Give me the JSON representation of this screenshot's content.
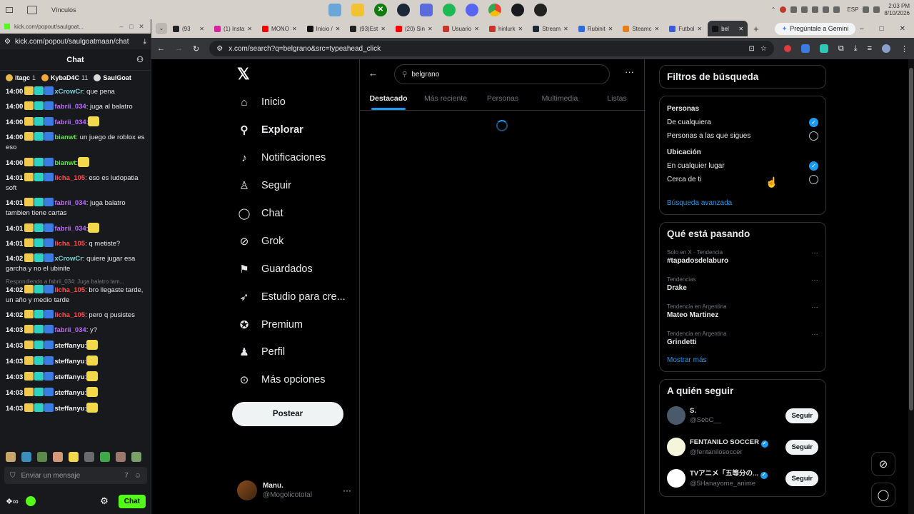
{
  "taskbar": {
    "vinculos": "Vínculos",
    "time": "2:03 PM",
    "date": "8/10/2026",
    "lang": "ESP"
  },
  "kick": {
    "title_url": "kick.com/popout/saulgoat...",
    "url": "kick.com/popout/saulgoatmaan/chat",
    "header": "Chat",
    "gifters": [
      {
        "name": "itagc",
        "count": "1"
      },
      {
        "name": "KybaD4C",
        "count": "11"
      },
      {
        "name": "SaulGoat",
        "count": ""
      }
    ],
    "messages": [
      {
        "time": "14:00",
        "user": "xCrowCr",
        "color": "#7fd1d6",
        "text": ": que pena"
      },
      {
        "time": "14:00",
        "user": "fabrii_034",
        "color": "#c06bff",
        "text": ": juga al balatro"
      },
      {
        "time": "14:00",
        "user": "fabrii_034",
        "color": "#c06bff",
        "text": ":"
      },
      {
        "time": "14:00",
        "user": "bianwt",
        "color": "#63e34f",
        "text": ": un juego de roblox es eso"
      },
      {
        "time": "14:00",
        "user": "bianwt",
        "color": "#63e34f",
        "text": ":"
      },
      {
        "time": "14:01",
        "user": "licha_105",
        "color": "#ff4d4d",
        "text": ": eso es ludopatia soft"
      },
      {
        "time": "14:01",
        "user": "fabrii_034",
        "color": "#c06bff",
        "text": ": juga balatro tambien tiene cartas"
      },
      {
        "time": "14:01",
        "user": "fabrii_034",
        "color": "#c06bff",
        "text": ":"
      },
      {
        "time": "14:01",
        "user": "licha_105",
        "color": "#ff4d4d",
        "text": ": q metiste?"
      },
      {
        "time": "14:02",
        "user": "xCrowCr",
        "color": "#7fd1d6",
        "text": ": quiere jugar esa garcha y no el ubinite"
      },
      {
        "time": "14:02",
        "user": "licha_105",
        "color": "#ff4d4d",
        "text": ": bro llegaste tarde, un año y medio tarde",
        "reply": "Respondiendo a fabrii_034: Juga balatro tam..."
      },
      {
        "time": "14:02",
        "user": "licha_105",
        "color": "#ff4d4d",
        "text": ": pero q pusistes"
      },
      {
        "time": "14:03",
        "user": "fabrii_034",
        "color": "#c06bff",
        "text": ": y?"
      },
      {
        "time": "14:03",
        "user": "steffanyu",
        "color": "#f2f2f2",
        "text": ":"
      },
      {
        "time": "14:03",
        "user": "steffanyu",
        "color": "#f2f2f2",
        "text": ":"
      },
      {
        "time": "14:03",
        "user": "steffanyu",
        "color": "#f2f2f2",
        "text": ":"
      },
      {
        "time": "14:03",
        "user": "steffanyu",
        "color": "#f2f2f2",
        "text": ":"
      },
      {
        "time": "14:03",
        "user": "steffanyu",
        "color": "#f2f2f2",
        "text": ":"
      }
    ],
    "input_placeholder": "Enviar un mensaje",
    "chat_button": "Chat"
  },
  "browser": {
    "tabs": [
      {
        "label": "(93",
        "color": "#222"
      },
      {
        "label": "(1) Insta",
        "color": "#d6249f"
      },
      {
        "label": "MONO",
        "color": "#ff0000"
      },
      {
        "label": "Inicio /",
        "color": "#111"
      },
      {
        "label": "(93)Est",
        "color": "#222"
      },
      {
        "label": "(20) Sin",
        "color": "#ff0000"
      },
      {
        "label": "Usuario",
        "color": "#c0392b"
      },
      {
        "label": "hinlurk",
        "color": "#c0392b"
      },
      {
        "label": "Stream",
        "color": "#1b2838"
      },
      {
        "label": "Rubinit",
        "color": "#2d6cdf"
      },
      {
        "label": "Steamc",
        "color": "#e67e22"
      },
      {
        "label": "Futbol",
        "color": "#3b5bdb"
      },
      {
        "label": "bel",
        "color": "#111",
        "active": true
      }
    ],
    "gemini": "Pregúntale a Gemini",
    "url": "x.com/search?q=belgrano&src=typeahead_click"
  },
  "x": {
    "nav": [
      {
        "label": "Inicio",
        "icon": "home-icon",
        "glyph": "⌂"
      },
      {
        "label": "Explorar",
        "icon": "search-icon",
        "glyph": "⚲",
        "bold": true
      },
      {
        "label": "Notificaciones",
        "icon": "bell-icon",
        "glyph": "♪"
      },
      {
        "label": "Seguir",
        "icon": "follow-icon",
        "glyph": "♙"
      },
      {
        "label": "Chat",
        "icon": "chat-icon",
        "glyph": "◯"
      },
      {
        "label": "Grok",
        "icon": "grok-icon",
        "glyph": "⊘"
      },
      {
        "label": "Guardados",
        "icon": "bookmark-icon",
        "glyph": "⚑"
      },
      {
        "label": "Estudio para cre...",
        "icon": "rocket-icon",
        "glyph": "➶"
      },
      {
        "label": "Premium",
        "icon": "premium-icon",
        "glyph": "✪"
      },
      {
        "label": "Perfil",
        "icon": "profile-icon",
        "glyph": "♟"
      },
      {
        "label": "Más opciones",
        "icon": "more-options-icon",
        "glyph": "⊙"
      }
    ],
    "post_button": "Postear",
    "user": {
      "name": "Manu.",
      "handle": "@Mogolicototal"
    },
    "search_value": "belgrano",
    "tabs": [
      "Destacado",
      "Más reciente",
      "Personas",
      "Multimedia",
      "Listas"
    ],
    "filters": {
      "title": "Filtros de búsqueda",
      "people_title": "Personas",
      "people_opts": [
        "De cualquiera",
        "Personas a las que sigues"
      ],
      "location_title": "Ubicación",
      "location_opts": [
        "En cualquier lugar",
        "Cerca de ti"
      ],
      "advanced": "Búsqueda avanzada"
    },
    "trends": {
      "title": "Qué está pasando",
      "items": [
        {
          "context": "Solo en X · Tendencia",
          "topic": "#tapadosdelaburo"
        },
        {
          "context": "Tendencias",
          "topic": "Drake"
        },
        {
          "context": "Tendencia en Argentina",
          "topic": "Mateo Martinez"
        },
        {
          "context": "Tendencia en Argentina",
          "topic": "Grindetti"
        }
      ],
      "show_more": "Mostrar más"
    },
    "who_to_follow": {
      "title": "A quién seguir",
      "items": [
        {
          "name": "S.",
          "handle": "@SebC__",
          "verified": false,
          "color": "#4a5a6a"
        },
        {
          "name": "FENTANILO SOCCER",
          "handle": "@fentanilosoccer",
          "verified": true,
          "color": "#f5f5dc"
        },
        {
          "name": "TVアニメ「五等分の...",
          "handle": "@5Hanayome_anime",
          "verified": true,
          "color": "#ffffff"
        }
      ],
      "button": "Seguir"
    }
  }
}
